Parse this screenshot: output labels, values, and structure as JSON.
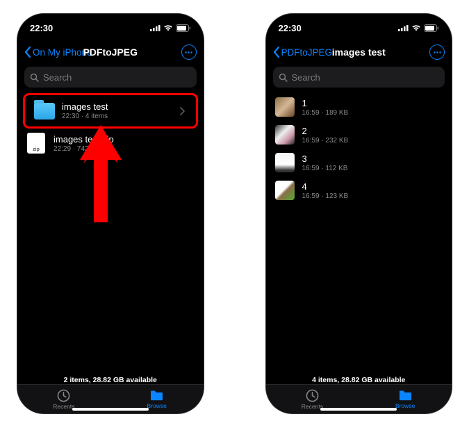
{
  "status": {
    "time": "22:30"
  },
  "left": {
    "back_label": "On My iPhone",
    "title": "PDFtoJPEG",
    "search_placeholder": "Search",
    "items": [
      {
        "name": "images test",
        "sub": "22:30 · 4 items",
        "kind": "folder"
      },
      {
        "name": "images test.zip",
        "sub": "22:29 · 742 KB",
        "kind": "zip"
      }
    ],
    "footer": "2 items, 28.82 GB available"
  },
  "right": {
    "back_label": "PDFtoJPEG",
    "title": "images test",
    "search_placeholder": "Search",
    "items": [
      {
        "name": "1",
        "sub": "16:59 · 189 KB"
      },
      {
        "name": "2",
        "sub": "16:59 · 232 KB"
      },
      {
        "name": "3",
        "sub": "16:59 · 112 KB"
      },
      {
        "name": "4",
        "sub": "16:59 · 123 KB"
      }
    ],
    "footer": "4 items, 28.82 GB available"
  },
  "tabs": {
    "recents": "Recents",
    "browse": "Browse"
  },
  "zip_badge": "zip"
}
